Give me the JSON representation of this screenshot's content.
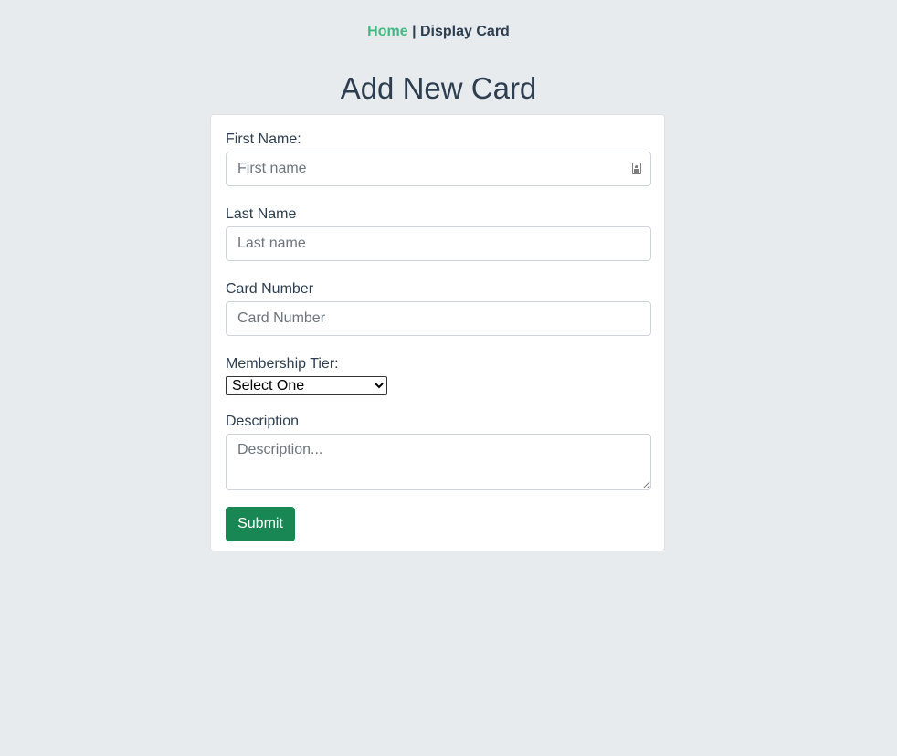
{
  "nav": {
    "home_label": "Home ",
    "separator": "| ",
    "display_card_label": "Display Card"
  },
  "page": {
    "title": "Add New Card"
  },
  "form": {
    "first_name": {
      "label": "First Name:",
      "placeholder": "First name",
      "value": ""
    },
    "last_name": {
      "label": "Last Name",
      "placeholder": "Last name",
      "value": ""
    },
    "card_number": {
      "label": "Card Number",
      "placeholder": "Card Number",
      "value": ""
    },
    "membership_tier": {
      "label": "Membership Tier:",
      "selected": "Select One"
    },
    "description": {
      "label": "Description",
      "placeholder": "Description...",
      "value": ""
    },
    "submit_label": "Submit"
  },
  "colors": {
    "background": "#e8ebee",
    "text": "#2c3e50",
    "active_link": "#42b983",
    "submit": "#198754"
  },
  "icons": {
    "first_name_autofill": "contact-card-icon",
    "select_arrow": "chevron-down-icon"
  }
}
